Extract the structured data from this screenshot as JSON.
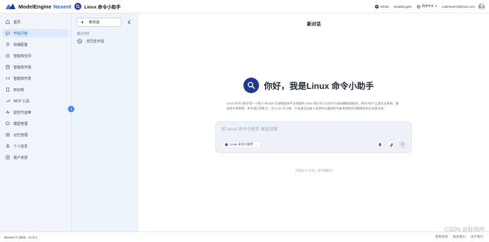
{
  "header": {
    "logo_text": "ModelEngine",
    "logo_accent": "Nexent",
    "agent_name": "Linux 命令小助手",
    "links": [
      {
        "label": "Github",
        "icon": "github-icon"
      },
      {
        "label": "ModelEngine",
        "icon": "modelengine-icon"
      },
      {
        "label": "简体中文",
        "icon": "globe-icon"
      }
    ],
    "user_email": "codertsu0728@163.com"
  },
  "sidebar": {
    "items": [
      {
        "label": "首页",
        "icon": "home-icon"
      },
      {
        "label": "开始问答",
        "icon": "chat-icon"
      },
      {
        "label": "快速配置",
        "icon": "rocket-icon"
      },
      {
        "label": "智能体空间",
        "icon": "bot-icon"
      },
      {
        "label": "智能体市场",
        "icon": "store-icon"
      },
      {
        "label": "智能体开发",
        "icon": "code-icon"
      },
      {
        "label": "知识库",
        "icon": "book-icon"
      },
      {
        "label": "MCP 工具",
        "icon": "tool-icon"
      },
      {
        "label": "监控与运维",
        "icon": "monitor-icon"
      },
      {
        "label": "模型管理",
        "icon": "model-icon"
      },
      {
        "label": "记忆管理",
        "icon": "memory-icon"
      },
      {
        "label": "个人信息",
        "icon": "user-icon"
      },
      {
        "label": "租户资源",
        "icon": "tenant-icon"
      }
    ],
    "active_index": 1
  },
  "conversations": {
    "new_chat_label": "新对话",
    "recent_label": "最近对话",
    "empty_label": "无历史对话"
  },
  "main": {
    "title": "新对话",
    "welcome": "你好，我是Linux 命令小助手",
    "description": "Linux 命令小助手是一个基于 Nexent 开源智能体平台构建的 Linux 知识学习与命令行查询辅助智能体。依托 MCP 工具生态系统、集成知识库管理、命令通记等能力，为 Linux 学习者、开发者及运维人员提供从基础命令查询到复杂问题解答的全流程支持。",
    "input_placeholder": "给 Linux 命令小助手 发送消息",
    "agent_select_label": "Linux 命令小助手",
    "disclaimer": "内容由 AI 生成，请仔细甄别"
  },
  "footer": {
    "version": "Nexent © 2026 · v1.8.1",
    "links": [
      "使用条款",
      "联系我们",
      "关于我们"
    ],
    "watermark": "CSDN @聆风吟"
  },
  "colors": {
    "accent": "#2563eb",
    "sidebar_bg": "#f1f5fb",
    "active_bg": "#dbeafe",
    "agent_avatar": "#1e3a8a"
  }
}
